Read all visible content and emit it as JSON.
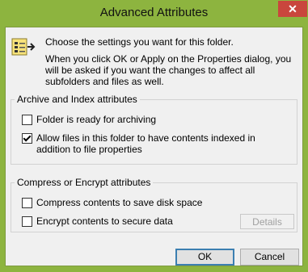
{
  "window": {
    "title": "Advanced Attributes",
    "close_label": "✕"
  },
  "description": {
    "line1": "Choose the settings you want for this folder.",
    "line2": "When you click OK or Apply on the Properties dialog, you will be asked if you want the changes to affect all subfolders and files as well."
  },
  "archive_group": {
    "label": "Archive and Index attributes",
    "options": [
      {
        "label": "Folder is ready for archiving",
        "checked": false
      },
      {
        "label": "Allow files in this folder to have contents indexed in addition to file properties",
        "checked": true
      }
    ]
  },
  "compress_group": {
    "label": "Compress or Encrypt attributes",
    "options": [
      {
        "label": "Compress contents to save disk space",
        "checked": false
      },
      {
        "label": "Encrypt contents to secure data",
        "checked": false
      }
    ],
    "details_label": "Details"
  },
  "buttons": {
    "ok": "OK",
    "cancel": "Cancel"
  },
  "colors": {
    "titlebar": "#8db43f",
    "client": "#f0f0f0",
    "close": "#c9463d"
  }
}
